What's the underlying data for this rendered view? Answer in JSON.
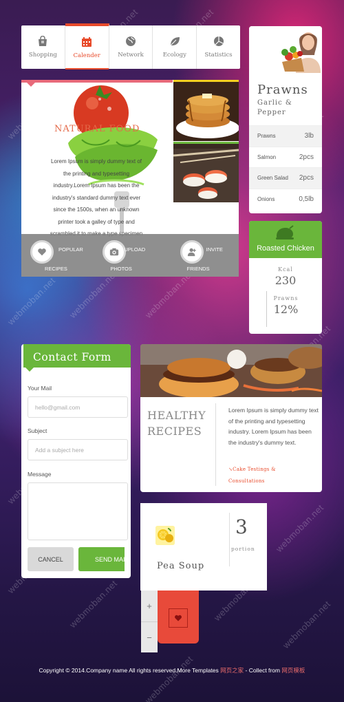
{
  "colors": {
    "accent_red": "#e84a2a",
    "accent_green": "#6ab63b",
    "gray_bar": "#808080"
  },
  "nav": {
    "tabs": [
      {
        "label": "Shopping",
        "icon": "shopping-bag-icon",
        "active": false
      },
      {
        "label": "Calender",
        "icon": "calendar-icon",
        "active": true
      },
      {
        "label": "Network",
        "icon": "globe-icon",
        "active": false
      },
      {
        "label": "Ecology",
        "icon": "leaf-icon",
        "active": false
      },
      {
        "label": "Statistics",
        "icon": "pie-chart-icon",
        "active": false
      }
    ]
  },
  "profile": {
    "name": "Prawns",
    "subtitle_line1": "Garlic &",
    "subtitle_line2": "Pepper",
    "ingredients": [
      {
        "name": "Prawns",
        "amount": "3lb"
      },
      {
        "name": "Salmon",
        "amount": "2pcs"
      },
      {
        "name": "Green Salad",
        "amount": "2pcs"
      },
      {
        "name": "Onions",
        "amount": "0,5lb"
      }
    ]
  },
  "food": {
    "heading": "NATURAL FOOD",
    "lines": [
      "Lorem Ipsum is simply dummy text of",
      "the printing and typesetting",
      "industry.Lorem Ipsum has been the",
      "industry's standard dummy text ever",
      "since the 1500s, when an unknown",
      "printer took a galley of type and",
      "scrambled it to make a type specimen"
    ],
    "actions": [
      {
        "top": "POPULAR",
        "bottom": "RECIPES",
        "icon": "heart-icon"
      },
      {
        "top": "UPLOAD",
        "bottom": "PHOTOS",
        "icon": "camera-icon"
      },
      {
        "top": "INVITE",
        "bottom": "FRIENDS",
        "icon": "add-user-icon"
      }
    ]
  },
  "chicken": {
    "title": "Roasted Chicken",
    "kcal_label": "Kcal",
    "kcal_value": "230",
    "prawns_label": "Prawns",
    "prawns_value": "12%"
  },
  "contact": {
    "title": "Contact Form",
    "mail_label": "Your Mail",
    "mail_placeholder": "hello@gmail.com",
    "subject_label": "Subject",
    "subject_placeholder": "Add a subject here",
    "message_label": "Message",
    "cancel_label": "CANCEL",
    "send_label": "SEND MAIL"
  },
  "healthy": {
    "title_line1": "HEALTHY",
    "title_line2": "RECIPES",
    "text": "Lorem Ipsum is simply dummy text of the printing and typesetting industry. Lorem Ipsum has been the industry's dummy text.",
    "link_line1": "Cake Testings &",
    "link_line2": "Consultations"
  },
  "pea": {
    "title": "Pea Soup",
    "portion_value": "3",
    "portion_label": "portion"
  },
  "zoom": {
    "plus": "+",
    "minus": "−"
  },
  "footer": {
    "text": "Copyright © 2014.Company name All rights reserved.More Templates ",
    "link1": "网页之家",
    "mid": " - Collect from ",
    "link2": "网页模板"
  },
  "watermark": "webmoban.net"
}
